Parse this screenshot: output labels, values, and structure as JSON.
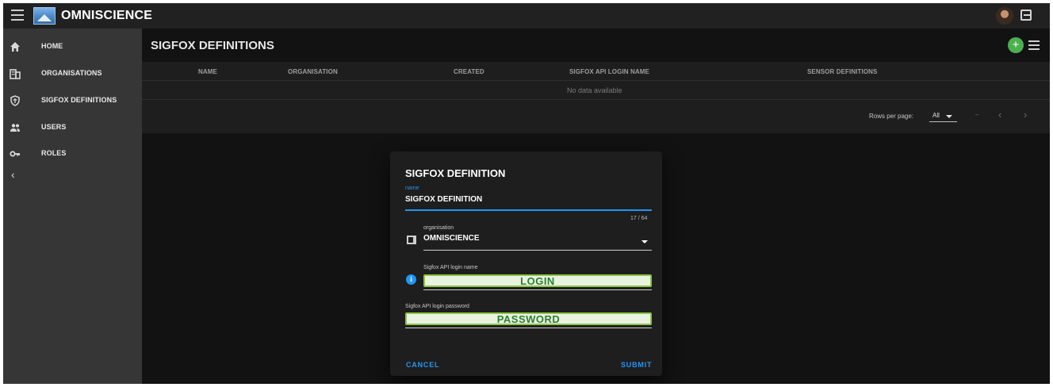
{
  "app": {
    "brand": "OMNISCIENCE"
  },
  "sidebar": {
    "items": [
      {
        "label": "HOME",
        "icon": "home-icon"
      },
      {
        "label": "ORGANISATIONS",
        "icon": "domain-icon"
      },
      {
        "label": "SIGFOX DEFINITIONS",
        "icon": "chip-icon"
      },
      {
        "label": "USERS",
        "icon": "users-icon"
      },
      {
        "label": "ROLES",
        "icon": "key-icon"
      }
    ],
    "collapse_glyph": "‹"
  },
  "main": {
    "title": "SIGFOX DEFINITIONS",
    "add_glyph": "+",
    "table": {
      "headers": [
        "NAME",
        "ORGANISATION",
        "CREATED",
        "SIGFOX API LOGIN NAME",
        "SENSOR DEFINITIONS"
      ],
      "no_data": "No data available",
      "rows_per_page_label": "Rows per page:",
      "rows_per_page_value": "All",
      "range": "–",
      "prev_glyph": "‹",
      "next_glyph": "›"
    }
  },
  "dialog": {
    "title": "SIGFOX DEFINITION",
    "name_label": "name",
    "name_value": "SIGFOX DEFINITION",
    "counter": "17 / 64",
    "org_label": "organisation",
    "org_value": "OMNISCIENCE",
    "login_label": "Sigfox API login name",
    "login_value": "LOGIN",
    "password_label": "Sigfox API login password",
    "password_value": "PASSWORD",
    "info_glyph": "i",
    "cancel_label": "CANCEL",
    "submit_label": "SUBMIT"
  },
  "colors": {
    "accent": "#2196f3",
    "add_button": "#4caf50",
    "sidebar_bg": "#363636",
    "topbar_bg": "#212121",
    "page_bg": "#121212",
    "highlight_border": "#8bc34a"
  }
}
